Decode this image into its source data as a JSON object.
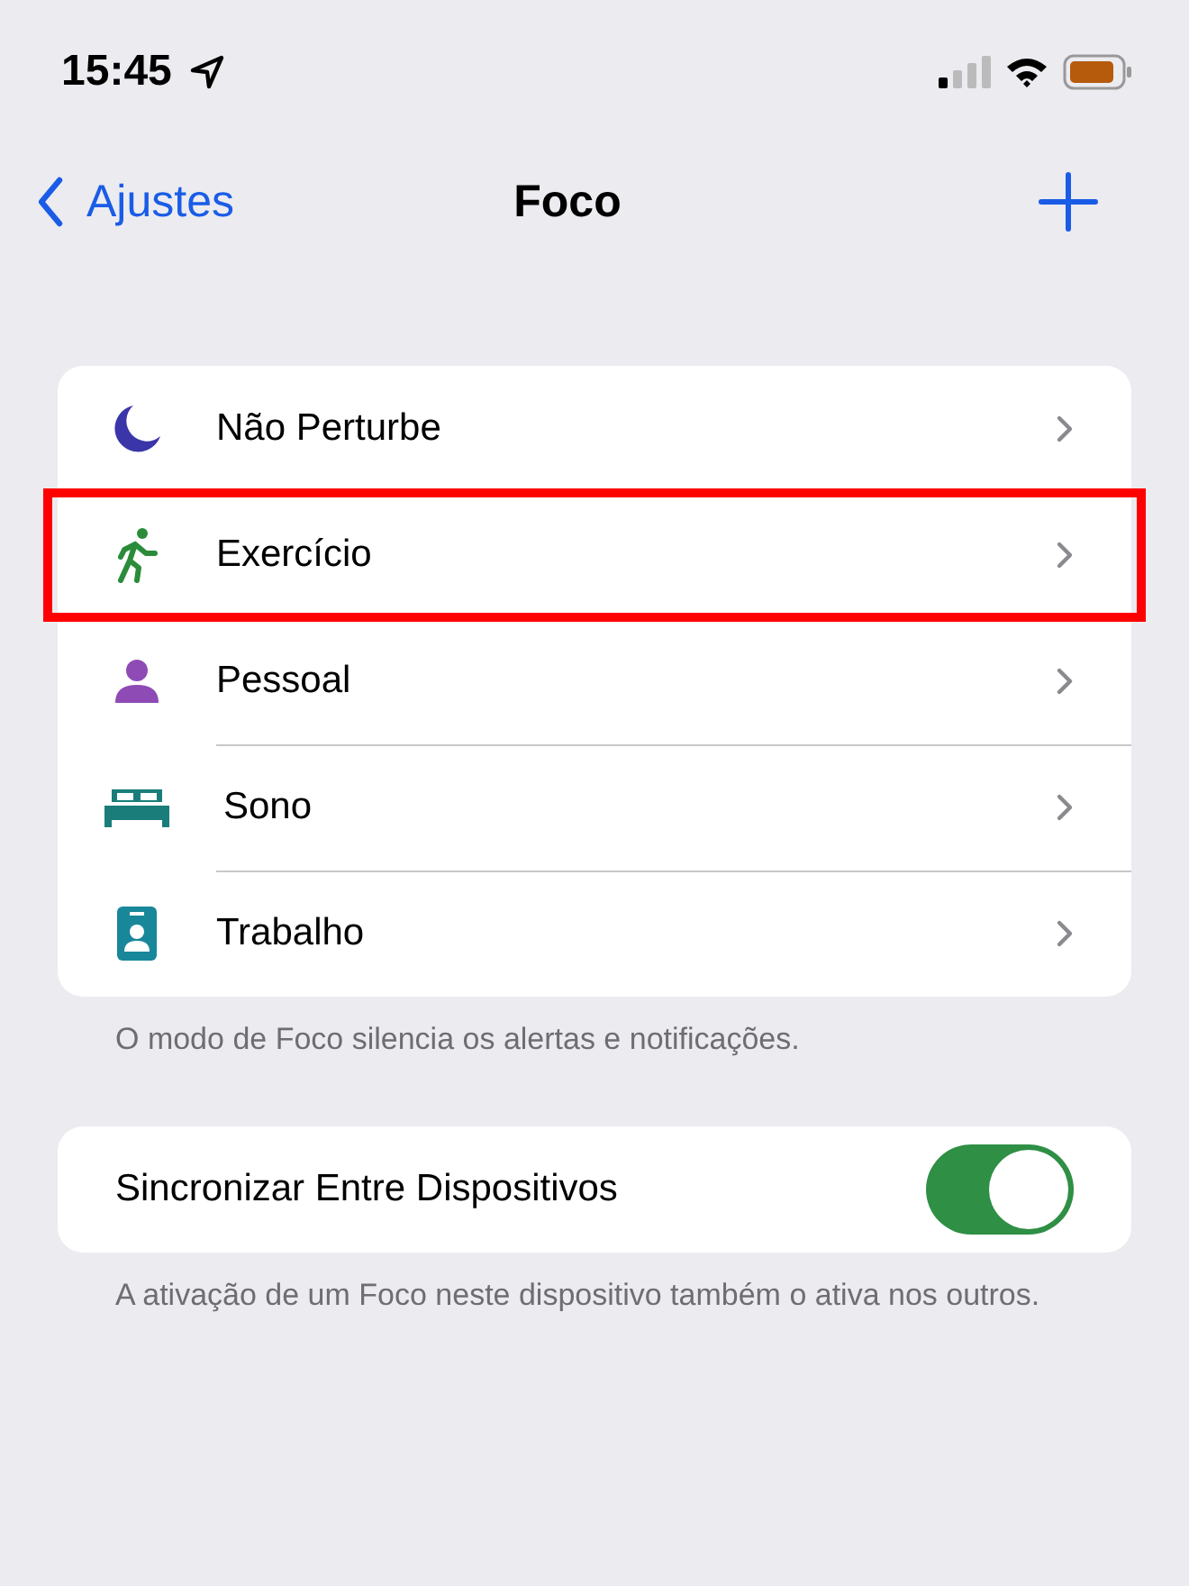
{
  "status_bar": {
    "time": "15:45"
  },
  "nav": {
    "back": "Ajustes",
    "title": "Foco"
  },
  "focus_modes": [
    {
      "kind": "moon",
      "label": "Não Perturbe",
      "color": "#3a35a8",
      "highlighted": false
    },
    {
      "kind": "runner",
      "label": "Exercício",
      "color": "#2a8c3a",
      "highlighted": true
    },
    {
      "kind": "person",
      "label": "Pessoal",
      "color": "#8e4bb5",
      "highlighted": false
    },
    {
      "kind": "bed",
      "label": "Sono",
      "color": "#1a7d7a",
      "highlighted": false
    },
    {
      "kind": "badge",
      "label": "Trabalho",
      "color": "#18879a",
      "highlighted": false
    }
  ],
  "focus_footer": "O modo de Foco silencia os alertas e notificações.",
  "sync": {
    "label": "Sincronizar Entre Dispositivos",
    "on": true
  },
  "sync_footer": "A ativação de um Foco neste dispositivo também o ativa nos outros."
}
